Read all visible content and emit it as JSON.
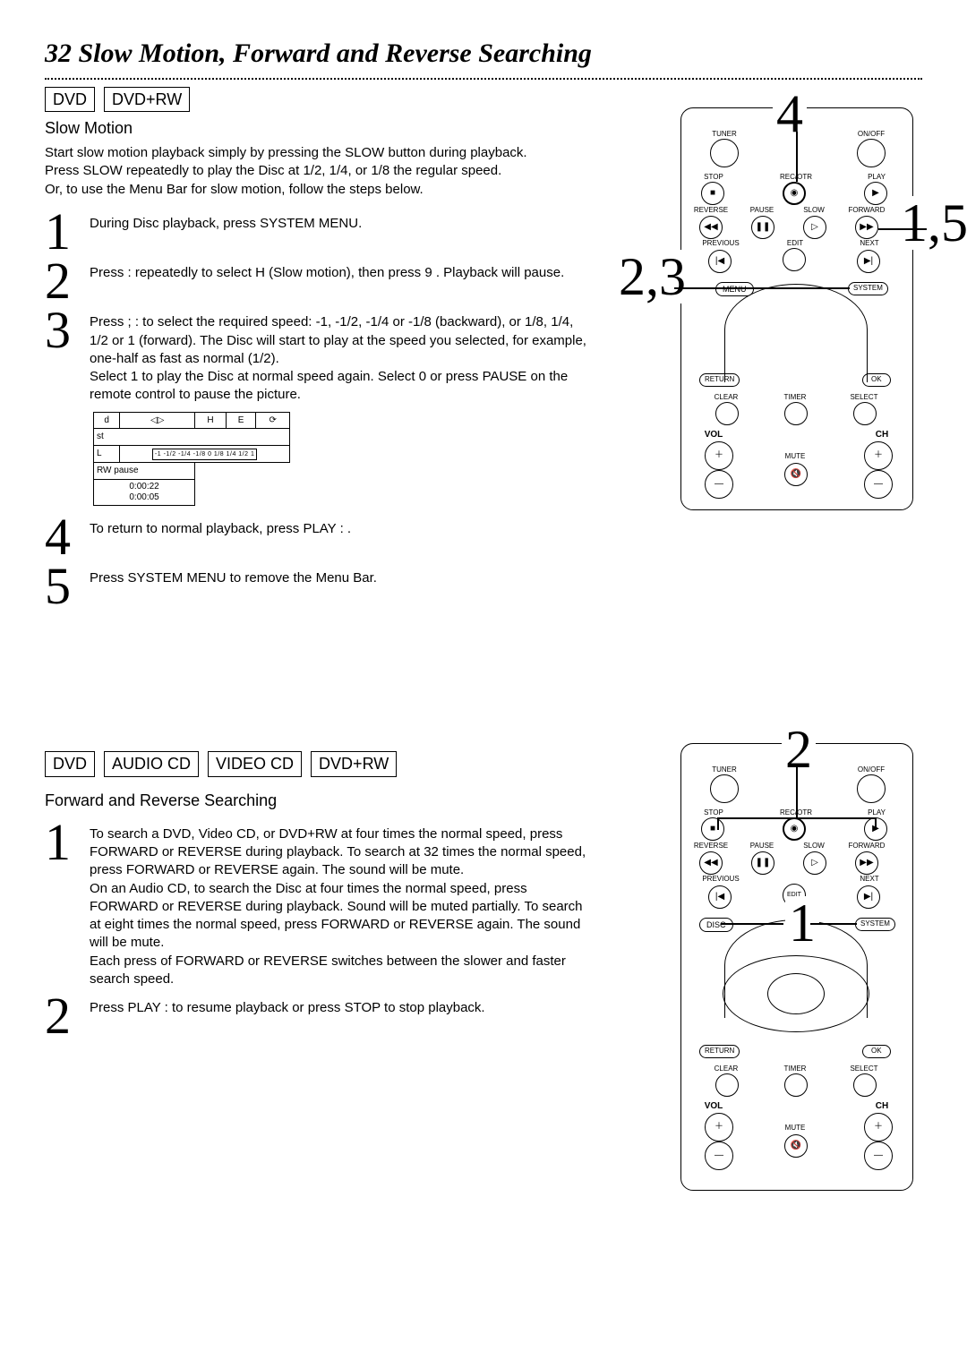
{
  "title": "32  Slow Motion, Forward and Reverse Searching",
  "section1": {
    "formats": [
      "DVD",
      "DVD+RW"
    ],
    "heading": "Slow Motion",
    "intro": "Start slow motion playback simply by pressing the SLOW button during playback. Press SLOW repeatedly to play the Disc at 1/2, 1/4, or 1/8 the regular speed.\nOr, to use the Menu Bar for slow motion, follow the steps below.",
    "steps": [
      {
        "n": "1",
        "t": "During Disc playback, press SYSTEM MENU."
      },
      {
        "n": "2",
        "t": "Press : repeatedly to select  H  (Slow motion), then press 9 . Playback will pause."
      },
      {
        "n": "3",
        "t": "Press ;  :  to select the required speed: -1, -1/2, -1/4 or -1/8 (backward), or 1/8, 1/4, 1/2 or 1 (forward).    The Disc will start to play at the speed you selected, for example, one-half as fast as normal (1/2).\nSelect 1 to play the Disc at normal speed again. Select 0 or press PAUSE   on the remote control to pause the picture."
      },
      {
        "n": "4",
        "t": "To return to normal playback, press PLAY    : ."
      },
      {
        "n": "5",
        "t": "Press SYSTEM MENU  to remove the Menu Bar."
      }
    ],
    "osd": {
      "header_row": [
        "d",
        "◁▷",
        "H",
        "E",
        "⟳"
      ],
      "row2": "st",
      "speeds": "-1 -1/2 -1/4 -1/8   0   1/8 1/4 1/2 1",
      "side_left_top": "L",
      "side_left_mid": "RW  pause",
      "time1": "0:00:22",
      "time2": "0:00:05"
    }
  },
  "section2": {
    "formats": [
      "DVD",
      "AUDIO CD",
      "VIDEO CD",
      "DVD+RW"
    ],
    "heading": "Forward and Reverse Searching",
    "steps": [
      {
        "n": "1",
        "t": "To search a DVD, Video CD, or DVD+RW at four times the normal speed, press FORWARD        or REVERSE during playback.  To search at 32 times the normal speed, press FORWARD        or REVERSE       again. The sound will be mute.\nOn an Audio CD, to search the Disc at four times the normal speed, press FORWARD       or REVERSE       during playback.  Sound will be muted partially. To search at eight times the normal speed, press FORWARD    or REVERSE      again.  The sound will be mute.\nEach press of FORWARD       or REVERSE      switches between the slower and faster search speed."
      },
      {
        "n": "2",
        "t": "Press PLAY :  to resume playback or press STOP       to stop playback."
      }
    ]
  },
  "remote": {
    "tuner": "TUNER",
    "onoff": "ON/OFF",
    "stop": "STOP",
    "rec": "REC/OTR",
    "play": "PLAY",
    "reverse": "REVERSE",
    "pause": "PAUSE",
    "slow": "SLOW",
    "forward": "FORWARD",
    "previous": "PREVIOUS",
    "edit": "EDIT",
    "next": "NEXT",
    "menu": "MENU",
    "disc": "DISC",
    "system": "SYSTEM",
    "return": "RETURN",
    "ok": "OK",
    "clear": "CLEAR",
    "timer": "TIMER",
    "select": "SELECT",
    "vol": "VOL",
    "ch": "CH",
    "mute": "MUTE",
    "glyph_stop": "■",
    "glyph_rec": "◉",
    "glyph_play": "▶",
    "glyph_rev": "◀◀",
    "glyph_pause": "❚❚",
    "glyph_slow": "▷",
    "glyph_fwd": "▶▶",
    "glyph_prev": "|◀",
    "glyph_next": "▶|",
    "glyph_plus": "＋",
    "glyph_minus": "—",
    "glyph_mute": "🔇"
  },
  "callouts": {
    "top_4": "4",
    "top_15": "1,5",
    "top_23": "2,3",
    "bot_2": "2",
    "bot_1": "1"
  }
}
